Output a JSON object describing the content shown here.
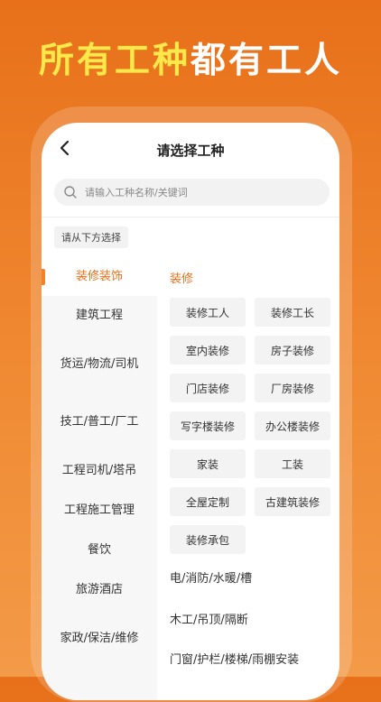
{
  "headline": {
    "part1": "所有工种",
    "part2": "都有工人"
  },
  "nav": {
    "title": "请选择工种"
  },
  "search": {
    "placeholder": "请输入工种名称/关键词"
  },
  "hint": "请从下方选择",
  "categories": [
    {
      "label": "装修装饰",
      "active": true
    },
    {
      "label": "建筑工程"
    },
    {
      "label": "货运/物流/司机"
    },
    {
      "label": "技工/普工/厂工"
    },
    {
      "label": "工程司机/塔吊"
    },
    {
      "label": "工程施工管理"
    },
    {
      "label": "餐饮"
    },
    {
      "label": "旅游酒店"
    },
    {
      "label": "家政/保洁/维修"
    }
  ],
  "section": {
    "title": "装修",
    "tags": [
      "装修工人",
      "装修工长",
      "室内装修",
      "房子装修",
      "门店装修",
      "厂房装修",
      "写字楼装修",
      "办公楼装修",
      "家装",
      "工装",
      "全屋定制",
      "古建筑装修",
      "装修承包"
    ]
  },
  "subgroups": [
    "电/消防/水暖/槽",
    "木工/吊顶/隔断",
    "门窗/护栏/楼梯/雨棚安装"
  ],
  "colors": {
    "accent": "#E8701A",
    "highlight": "#FFE84A"
  }
}
